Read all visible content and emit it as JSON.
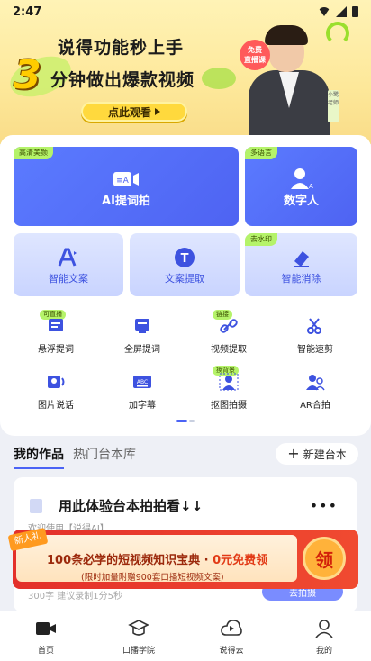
{
  "status_bar": {
    "time": "2:47"
  },
  "banner": {
    "line1": "说得功能秒上手",
    "big_number": "3",
    "line2": "分钟做出爆款视频",
    "cta_label": "点此观看",
    "person_tag": "免费\n直播课",
    "side_label": "小鹭老师"
  },
  "tools": {
    "big_cards": [
      {
        "tag": "高清美颜",
        "label": "AI提词拍"
      },
      {
        "tag": "多语言",
        "label": "数字人"
      }
    ],
    "small_cards": [
      {
        "tag": "",
        "label": "智能文案"
      },
      {
        "tag": "",
        "label": "文案提取"
      },
      {
        "tag": "去水印",
        "label": "智能消除"
      }
    ],
    "grid": [
      {
        "tag": "可直播",
        "label": "悬浮提词"
      },
      {
        "tag": "",
        "label": "全屏提词"
      },
      {
        "tag": "链接",
        "label": "视频提取"
      },
      {
        "tag": "",
        "label": "智能速剪"
      },
      {
        "tag": "",
        "label": "图片说话"
      },
      {
        "tag": "",
        "label": "加字幕"
      },
      {
        "tag": "換背景",
        "label": "抠图拍摄"
      },
      {
        "tag": "",
        "label": "AR合拍"
      }
    ],
    "grid_icon_text": [
      "ABC"
    ]
  },
  "works": {
    "tab_active": "我的作品",
    "tab_inactive": "热门台本库",
    "new_button": "新建台本",
    "card": {
      "title": "用此体验台本拍拍看↓↓",
      "subtitle": "欢迎使用【说得AI】",
      "meta": "300字 建议录制1分5秒",
      "action": "去拍摄"
    }
  },
  "promo": {
    "new_tag": "新人礼",
    "line1_a": "100条必学的短视频知识宝典 · ",
    "line1_b": "0元免费领",
    "line2": "(限时加量附赠900套口播短视频文案)",
    "get_label": "领"
  },
  "nav": [
    {
      "label": "首页",
      "active": true
    },
    {
      "label": "口播学院",
      "active": false
    },
    {
      "label": "说得云",
      "active": false
    },
    {
      "label": "我的",
      "active": false
    }
  ],
  "colors": {
    "accent": "#4b63f5",
    "promo_red": "#e3302a",
    "tag_green": "#b5f36a"
  }
}
